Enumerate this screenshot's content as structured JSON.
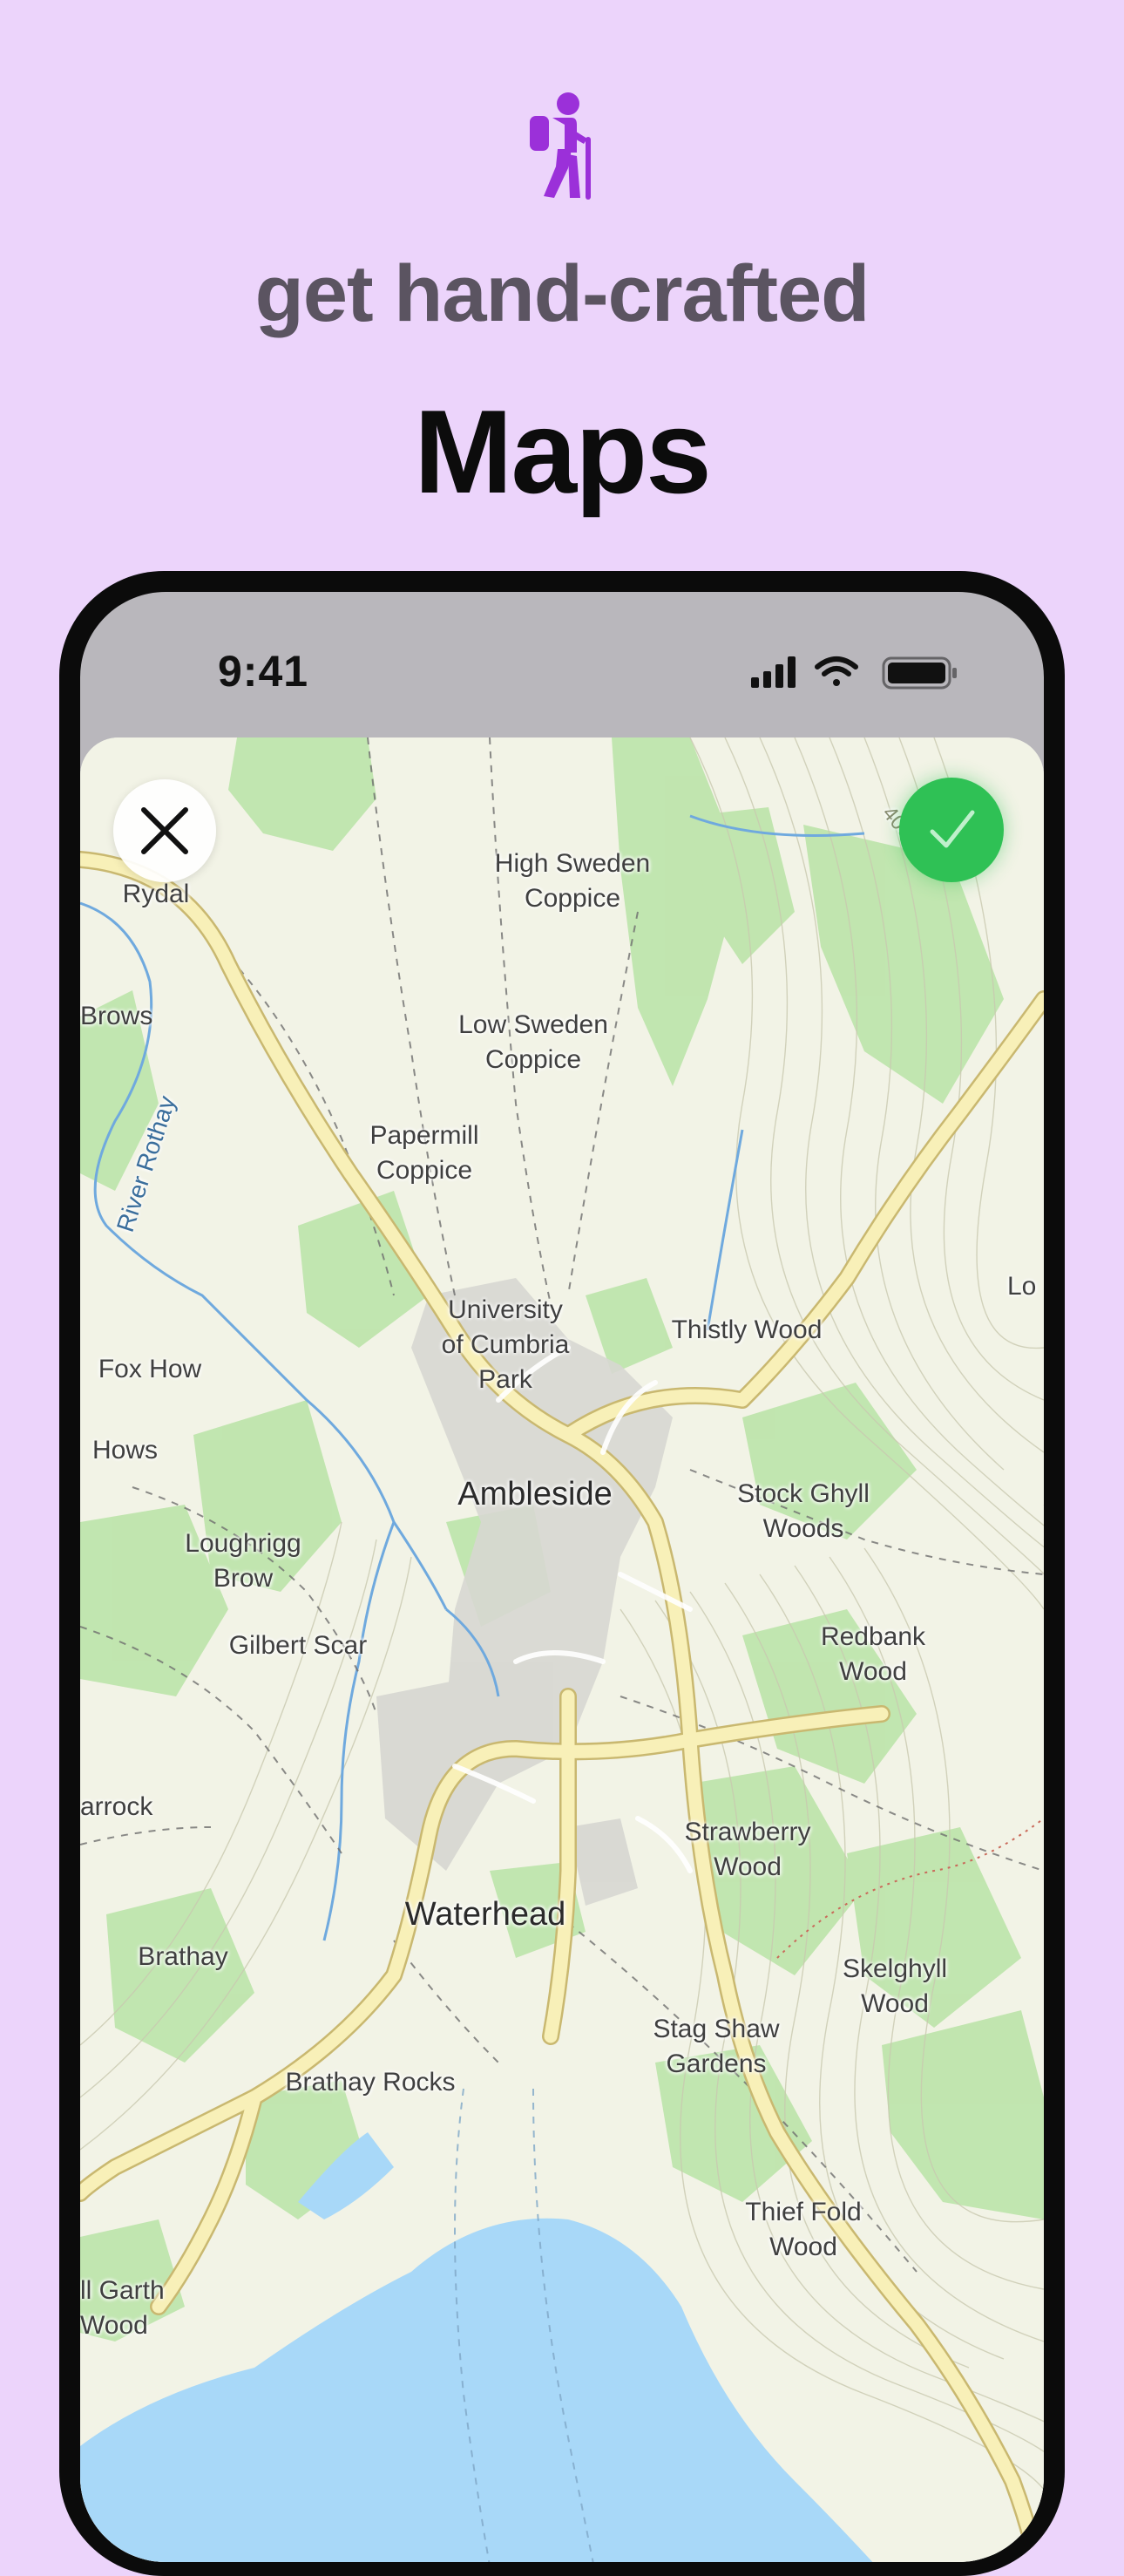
{
  "promo": {
    "tagline": "get hand-crafted",
    "headline": "Maps",
    "icon": "hiker-icon",
    "accent_color": "#9b30d9"
  },
  "status_bar": {
    "time": "9:41",
    "icons": [
      "cellular-signal-icon",
      "wifi-icon",
      "battery-icon"
    ]
  },
  "map": {
    "controls": {
      "close_icon": "close-icon",
      "confirm_icon": "checkmark-icon",
      "confirm_color": "#2fc155"
    },
    "labels": {
      "rydal": "Rydal",
      "brows": "Brows",
      "river_rothay": "River Rothay",
      "high_sweden_coppice": "High Sweden\nCoppice",
      "low_sweden_coppice": "Low Sweden\nCoppice",
      "papermill_coppice": "Papermill\nCoppice",
      "university_cumbria_park": "University\nof Cumbria\nPark",
      "thistly_wood": "Thistly Wood",
      "lo": "Lo",
      "fox_how": "Fox How",
      "hows": "Hows",
      "ambleside": "Ambleside",
      "stock_ghyll_woods": "Stock Ghyll\nWoods",
      "loughrigg_brow": "Loughrigg\nBrow",
      "gilbert_scar": "Gilbert Scar",
      "redbank_wood": "Redbank\nWood",
      "croft_arrock": "arrock",
      "strawberry_wood": "Strawberry\nWood",
      "waterhead": "Waterhead",
      "brathay": "Brathay",
      "skelghyll_wood": "Skelghyll\nWood",
      "stag_shaw_gardens": "Stag Shaw\nGardens",
      "brathay_rocks": "Brathay Rocks",
      "thief_fold_wood": "Thief Fold\nWood",
      "ll_garth_wood": "ll Garth\nWood",
      "contour_400": "400"
    }
  }
}
